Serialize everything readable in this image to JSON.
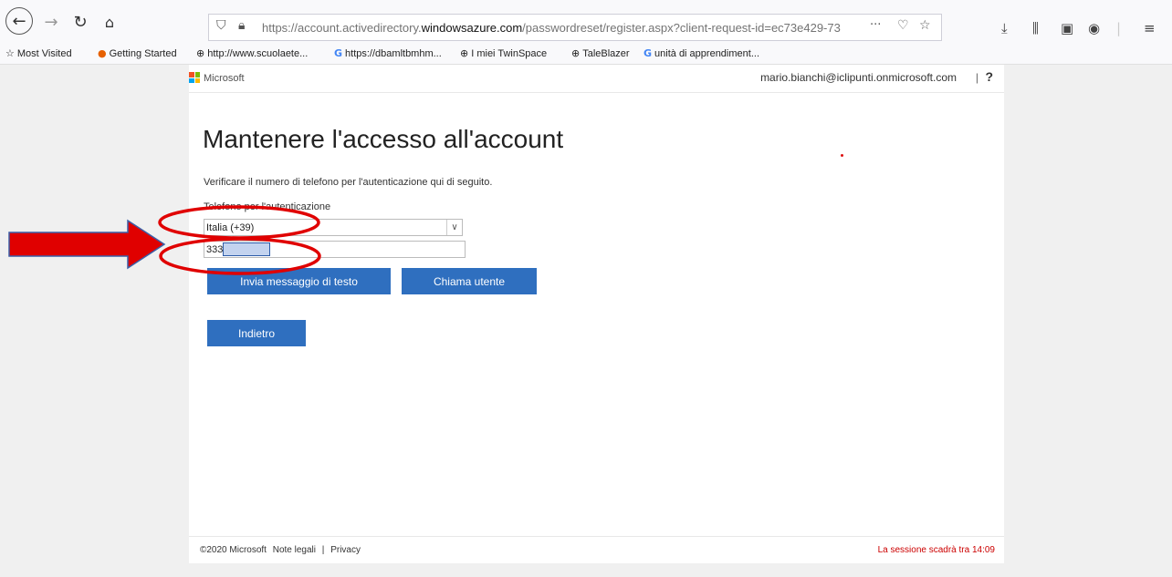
{
  "browser": {
    "url_prefix": "https://account.activedirectory.",
    "url_domain": "windowsazure.com",
    "url_suffix": "/passwordreset/register.aspx?client-request-id=ec73e429-73",
    "page_actions": "···",
    "bookmarks": [
      {
        "icon": "☆",
        "label": "Most Visited"
      },
      {
        "icon": "●",
        "label": "Getting Started"
      },
      {
        "icon": "⊕",
        "label": "http://www.scuolaete..."
      },
      {
        "icon": "G",
        "label": "https://dbamltbmhm..."
      },
      {
        "icon": "⊕",
        "label": "I miei TwinSpace"
      },
      {
        "icon": "⊕",
        "label": "TaleBlazer"
      },
      {
        "icon": "G",
        "label": "unità di apprendiment..."
      }
    ]
  },
  "header": {
    "brand": "Microsoft",
    "account": "mario.bianchi@iclipunti.onmicrosoft.com",
    "separator": "|",
    "help": "?"
  },
  "main": {
    "title": "Mantenere l'accesso all'account",
    "instructions": "Verificare il numero di telefono per l'autenticazione qui di seguito.",
    "phone_label": "Telefono per l'autenticazione",
    "country_value": "Italia (+39)",
    "phone_value": "333",
    "sms_button": "Invia messaggio di testo",
    "call_button": "Chiama utente",
    "back_button": "Indietro"
  },
  "footer": {
    "copyright": "©2020 Microsoft",
    "legal": "Note legali",
    "separator": "|",
    "privacy": "Privacy",
    "session": "La sessione scadrà tra 14:09"
  },
  "colors": {
    "primary_button": "#2f6fbf",
    "annotation_red": "#e00000",
    "session_text": "#cc0000"
  }
}
